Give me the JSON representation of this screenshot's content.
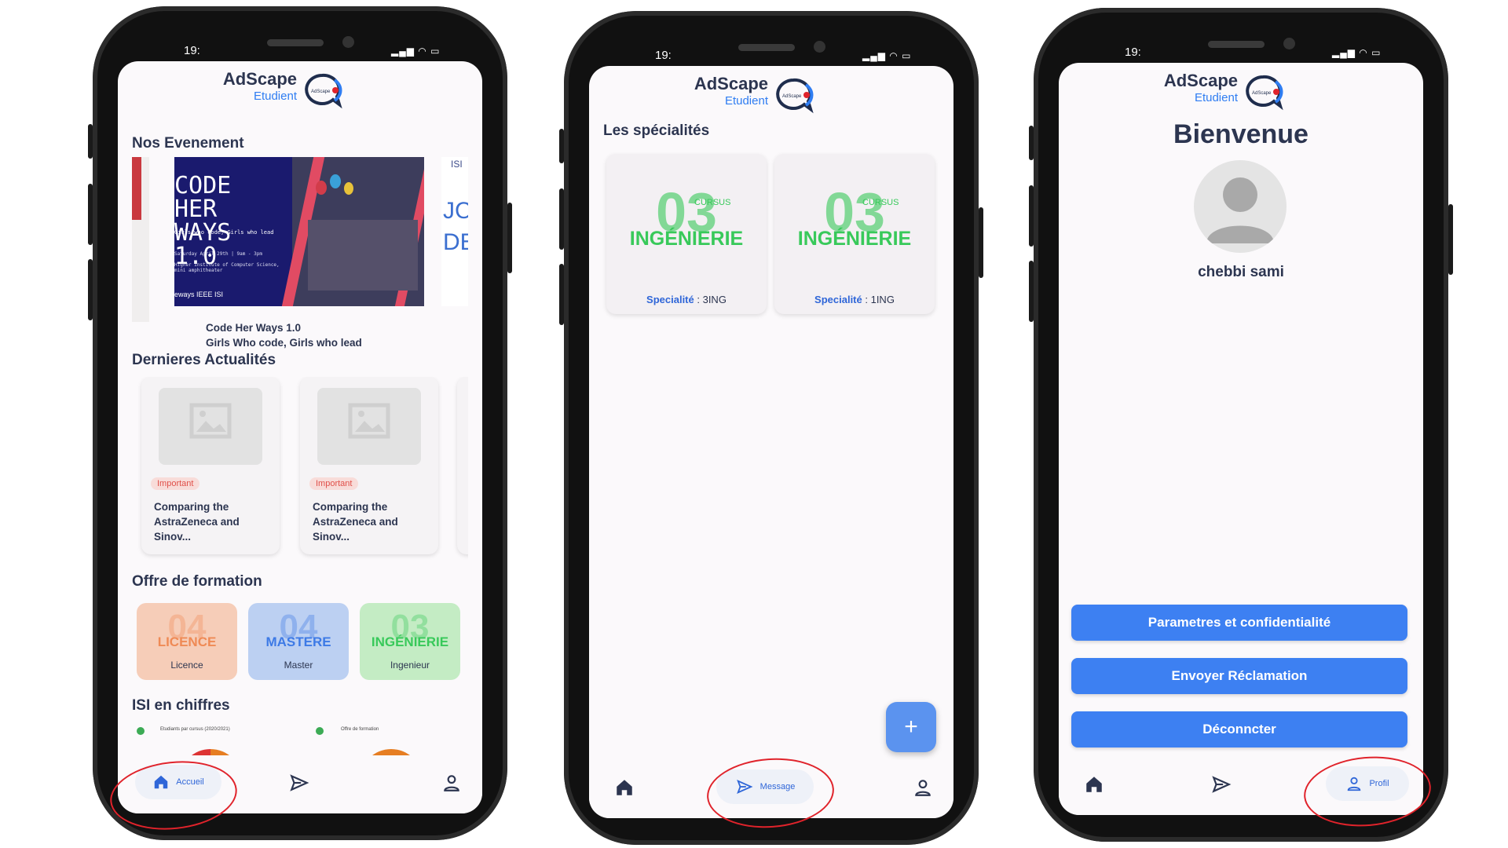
{
  "brand": {
    "name": "AdScape",
    "sub": "Etudient",
    "logo_text": "AdScape"
  },
  "status": {
    "time": "19:",
    "icons": "▂▄▆ ◠ ▭"
  },
  "home": {
    "events_title": "Nos Evenement",
    "event": {
      "banner_title": "CODE HER WAYS 1.0",
      "banner_sub": "Girls who code, Girls who lead",
      "banner_date": "Saturday April 29th | 9am - 3pm",
      "banner_place": "Higher Institute of Computer Science, mini amphitheater",
      "banner_sponsors": "eways  IEEE  ISI",
      "caption1": "Code Her Ways 1.0",
      "caption2": "Girls Who code, Girls who lead"
    },
    "next_event": {
      "a": "JC",
      "b": "DE",
      "c": "ISI"
    },
    "news_title": "Dernieres Actualités",
    "news": [
      {
        "tag": "Important",
        "text": "Comparing the AstraZeneca and Sinov..."
      },
      {
        "tag": "Important",
        "text": "Comparing the AstraZeneca and Sinov..."
      }
    ],
    "formation_title": "Offre de formation",
    "formations": [
      {
        "big": "04",
        "word": "LICENCE",
        "label": "Licence",
        "bg": "#f6cdb8",
        "color": "#ef8a55"
      },
      {
        "big": "04",
        "word": "MASTERE",
        "label": "Master",
        "bg": "#bcd0f2",
        "color": "#3d7ae6"
      },
      {
        "big": "03",
        "word": "INGÉNIERIE",
        "label": "Ingenieur",
        "bg": "#c4ecc4",
        "color": "#38c95a"
      }
    ],
    "stats_title": "ISI en chiffres",
    "stats": [
      {
        "label": "Etudiants par cursus (2020/2021)"
      },
      {
        "label": "Offre de formation"
      }
    ],
    "nav_active": "Accueil"
  },
  "message": {
    "title": "Les spécialités",
    "specs": [
      {
        "big": "03",
        "small": "CURSUS",
        "word": "INGÉNIERIE",
        "label_key": "Specialité",
        "label_val": " : 3ING"
      },
      {
        "big": "03",
        "small": "CURSUS",
        "word": "INGÉNIERIE",
        "label_key": "Specialité",
        "label_val": " : 1ING"
      }
    ],
    "fab": "+",
    "nav_active": "Message"
  },
  "profile": {
    "welcome": "Bienvenue",
    "name": "chebbi sami",
    "buttons": [
      "Parametres et confidentialité",
      "Envoyer Réclamation",
      "Déconncter"
    ],
    "nav_active": "Profil"
  },
  "colors": {
    "accent": "#3d80f2",
    "highlight_ring": "#e0232b",
    "tag_red": "#e0504a"
  }
}
